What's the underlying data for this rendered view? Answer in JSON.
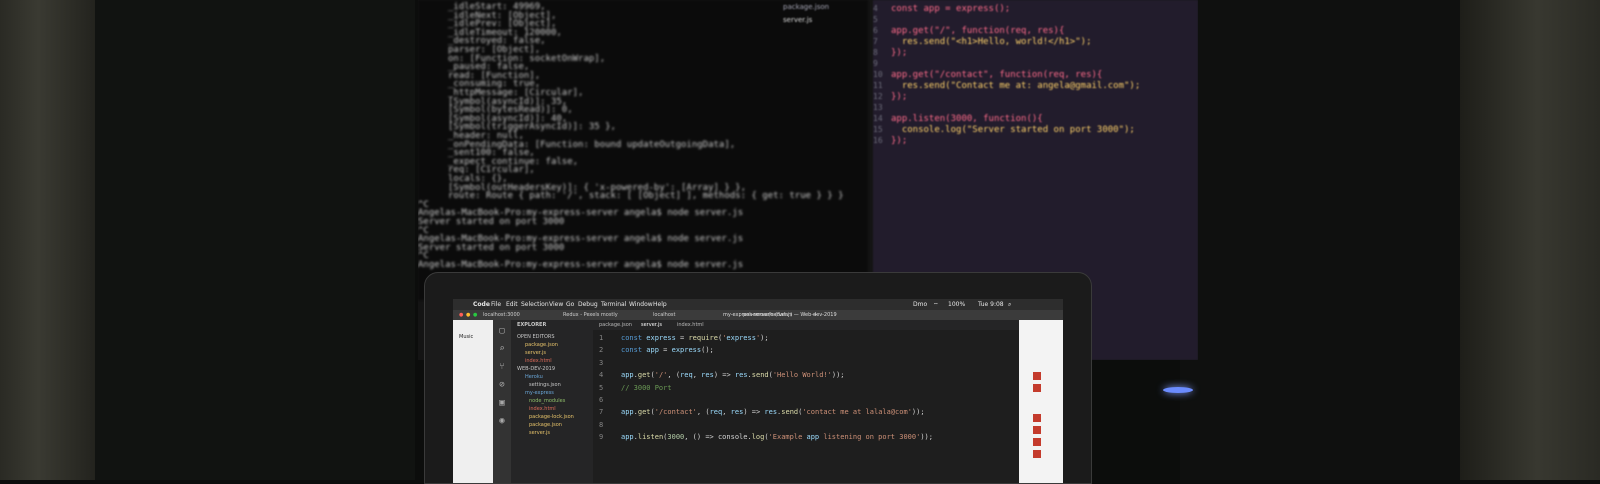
{
  "monitor": {
    "terminal_lines": [
      "_idleStart: 49969,",
      "_idleNext: [Object],",
      "_idlePrev: [Object],",
      "_idleTimeout: 120000,",
      "_destroyed: false,",
      "parser: [Object],",
      "on: [Function: socketOnWrap],",
      "_paused: false,",
      "read: [Function],",
      "_consuming: true,",
      "_httpMessage: [Circular],",
      "[Symbol(asyncId)]: 35,",
      "[Symbol(bytesRead)]: 0,",
      "[Symbol(asyncId)]: 40,",
      "[Symbol(triggerAsyncId)]: 35 },",
      "_header: null,",
      "_onPendingData: [Function: bound updateOutgoingData],",
      "_sent100: false,",
      "_expect_continue: false,",
      "req: [Circular],",
      "locals: {},",
      "[Symbol(outHeadersKey)]: { 'x-powered-by': [Array] } },",
      "route: Route { path: '/', stack: [ [Object] ], methods: { get: true } } }",
      "^C",
      "Angelas-MacBook-Pro:my-express-server angela$ node server.js",
      "Server started on port 3000",
      "^C",
      "Angelas-MacBook-Pro:my-express-server angela$ node server.js",
      "Server started on port 3000",
      "^C",
      "Angelas-MacBook-Pro:my-express-server angela$ node server.js"
    ],
    "editor_lines": [
      "const app = express();",
      "",
      "app.get(\"/\", function(req, res){",
      "  res.send(\"<h1>Hello, world!</h1>\");",
      "});",
      "",
      "app.get(\"/contact\", function(req, res){",
      "  res.send(\"Contact me at: angela@gmail.com\");",
      "});",
      "",
      "app.listen(3000, function(){",
      "  console.log(\"Server started on port 3000\");",
      "});"
    ],
    "editor_line_numbers": [
      "4",
      "5",
      "6",
      "7",
      "8",
      "9",
      "10",
      "11",
      "12",
      "13",
      "14",
      "15",
      "16"
    ],
    "sidebar_files": [
      "package.json",
      "server.js"
    ]
  },
  "laptop": {
    "menu": [
      "Code",
      "File",
      "Edit",
      "Selection",
      "View",
      "Go",
      "Debug",
      "Terminal",
      "Window",
      "Help"
    ],
    "status_right": [
      "Dmo",
      "100%",
      "Tue 9:08"
    ],
    "browser_tabs": [
      "localhost:3000",
      "Redux - Pexels mostly",
      "localhost",
      "pehemoselo (Safar)"
    ],
    "window_title": "my-express-server/server.js — Web-dev-2019",
    "editor_tabs": [
      "package.json",
      "server.js",
      "index.html"
    ],
    "explorer_title": "EXPLORER",
    "explorer_items": [
      "OPEN EDITORS",
      "package.json",
      "server.js",
      "index.html",
      "WEB-DEV-2019",
      "Heroku",
      "settings.json",
      "my-express",
      "node_modules",
      "index.html",
      "package-lock.json",
      "package.json",
      "server.js"
    ],
    "code_lines": [
      {
        "n": "1",
        "text": "const express = require('express');"
      },
      {
        "n": "2",
        "text": "const app = express();"
      },
      {
        "n": "3",
        "text": ""
      },
      {
        "n": "4",
        "text": "app.get('/', (req, res) => res.send('Hello World!'));"
      },
      {
        "n": "5",
        "text": "// 3000 Port"
      },
      {
        "n": "6",
        "text": ""
      },
      {
        "n": "7",
        "text": "app.get('/contact', (req, res) => res.send('contact me at lalala@com'));"
      },
      {
        "n": "8",
        "text": ""
      },
      {
        "n": "9",
        "text": "app.listen(3000, () => console.log('Example app listening on port 3000'));"
      }
    ],
    "browser_left_label": "Music"
  }
}
